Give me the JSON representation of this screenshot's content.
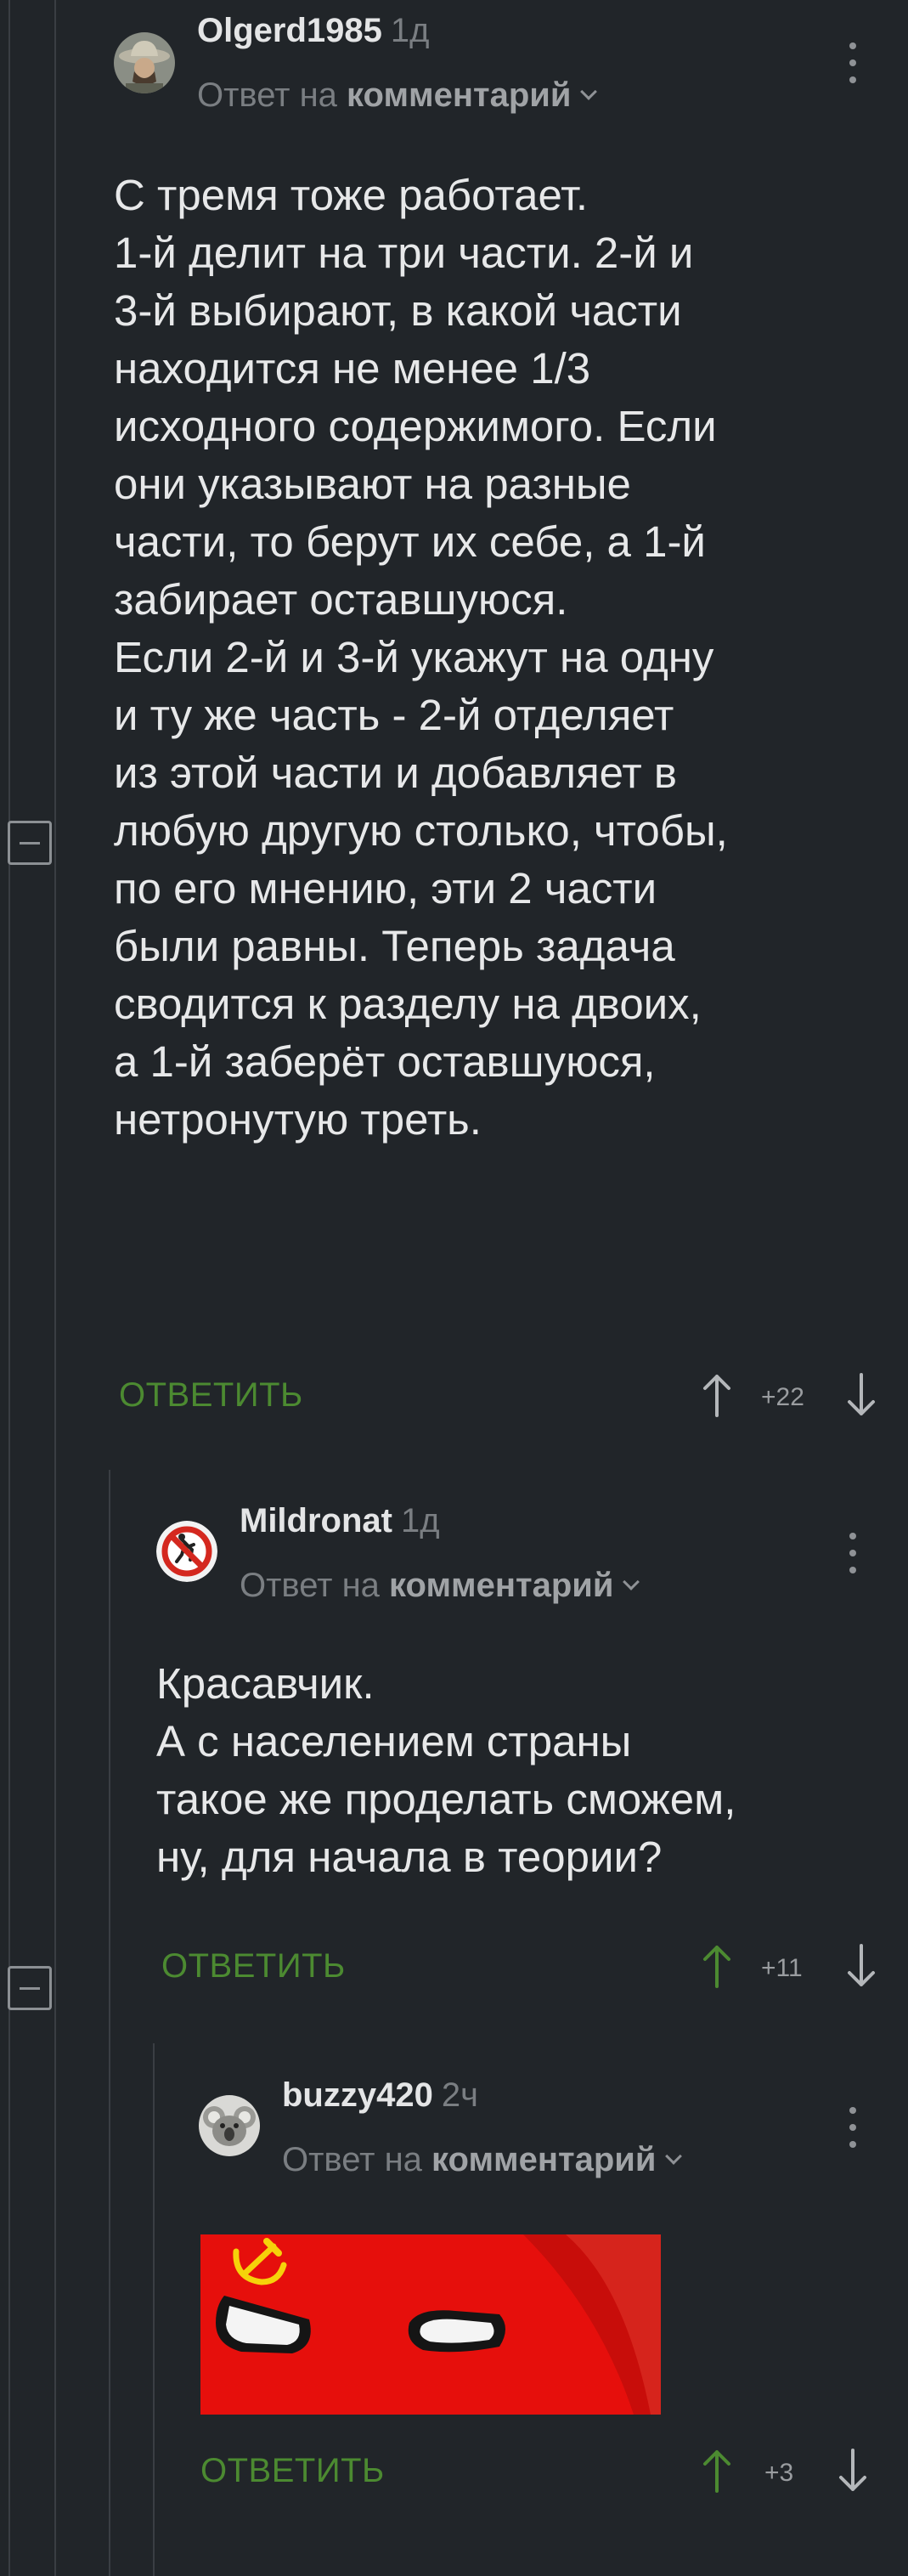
{
  "comments": [
    {
      "author": "Olgerd1985",
      "time": "1д",
      "reply_prefix": "Ответ на",
      "reply_target": "комментарий",
      "text": "С тремя тоже работает.\n1-й делит на три части. 2-й и\n3-й выбирают, в какой части\nнаходится не менее 1/3\nисходного содержимого. Если\nони указывают на разные\nчасти, то берут их себе, а 1-й\nзабирает оставшуюся.\nЕсли 2-й и 3-й укажут на одну\nи ту же часть - 2-й отделяет\nиз этой части и добавляет в\nлюбую другую столько, чтобы,\nпо его мнению, эти 2 части\nбыли равны. Теперь задача\nсводится к разделу на двоих,\nа 1-й заберёт оставшуюся,\nнетронутую треть.",
      "reply_label": "ОТВЕТИТЬ",
      "score": "+22",
      "avatar_icon": "cowboy-hat-avatar-icon"
    },
    {
      "author": "Mildronat",
      "time": "1д",
      "reply_prefix": "Ответ на",
      "reply_target": "комментарий",
      "text": "Красавчик.\nА с населением страны\nтакое же проделать сможем,\nну, для начала в теории?",
      "reply_label": "ОТВЕТИТЬ",
      "score": "+11",
      "avatar_icon": "no-entry-sign-avatar-icon",
      "up_arrow_color": "#4c8a31"
    },
    {
      "author": "buzzy420",
      "time": "2ч",
      "reply_prefix": "Ответ на",
      "reply_target": "комментарий",
      "reply_label": "ОТВЕТИТЬ",
      "score": "+3",
      "avatar_icon": "koala-avatar-icon",
      "image_icon": "ussr-countryball-image",
      "up_arrow_color": "#4c8a31"
    }
  ],
  "colors": {
    "background": "#212529",
    "accent_green": "#4c8a31",
    "muted_text": "#7a7e82",
    "thread_line": "#3a3e43"
  }
}
